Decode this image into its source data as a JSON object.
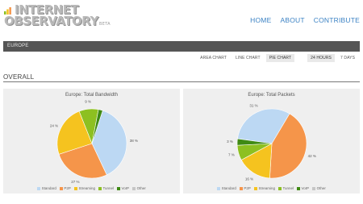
{
  "header": {
    "logo_line1": "INTERNET",
    "logo_line2": "OBSERVATORY",
    "logo_beta": "BETA",
    "nav": [
      "HOME",
      "ABOUT",
      "CONTRIBUTE"
    ]
  },
  "region": {
    "label": "EUROPE"
  },
  "view_tabs": {
    "chart_types": [
      "AREA CHART",
      "LINE CHART",
      "PIE CHART"
    ],
    "active_chart": "PIE CHART",
    "ranges": [
      "24 HOURS",
      "7 DAYS"
    ],
    "active_range": "24 HOURS"
  },
  "overall": {
    "title": "OVERALL"
  },
  "colors": {
    "Standard": "#bcd8f3",
    "P2P": "#f5954a",
    "Streaming": "#f5c31f",
    "Tunnel": "#8dc021",
    "VoIP": "#3f8a14",
    "Other": "#c6c6c6"
  },
  "legend": [
    "Standard",
    "P2P",
    "Streaming",
    "Tunnel",
    "VoIP",
    "Other"
  ],
  "chart_data": [
    {
      "type": "pie",
      "title": "Europe: Total Bandwidth",
      "categories": [
        "Standard",
        "P2P",
        "Streaming",
        "Tunnel",
        "VoIP",
        "Other"
      ],
      "values": [
        38,
        27,
        24,
        9,
        2,
        0
      ],
      "labels": [
        "38 %",
        "27 %",
        "24 %",
        "9 %",
        "",
        ""
      ]
    },
    {
      "type": "pie",
      "title": "Europe: Total Packets",
      "categories": [
        "Standard",
        "P2P",
        "Streaming",
        "Tunnel",
        "VoIP",
        "Other"
      ],
      "values": [
        31,
        42,
        16,
        7,
        3,
        0
      ],
      "labels": [
        "31 %",
        "42 %",
        "16 %",
        "7 %",
        "3 %",
        ""
      ]
    }
  ]
}
